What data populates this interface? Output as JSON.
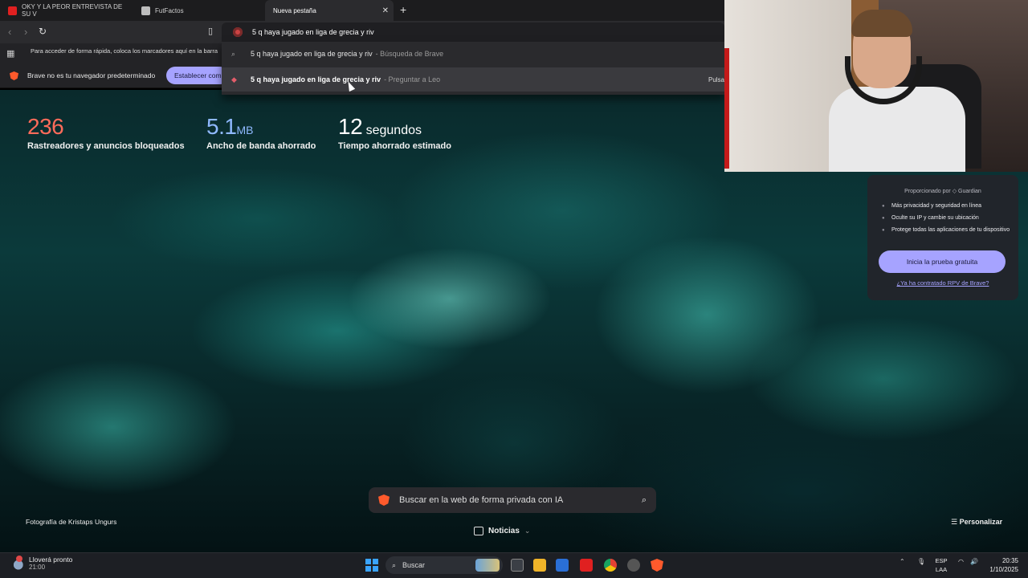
{
  "tabs": [
    {
      "title": "OKY Y LA PEOR ENTREVISTA DE SU V",
      "color": "#e02020"
    },
    {
      "title": "FutFactos",
      "color": "#cccccc"
    },
    {
      "title": "Nueva pestaña",
      "color": "#ffffff",
      "active": true
    }
  ],
  "omnibox": {
    "value": "5 q haya jugado en liga de grecia y riv"
  },
  "bookmarks_hint": "Para acceder de forma rápida, coloca los marcadores aquí en la barra",
  "infobar": {
    "message": "Brave no es tu navegador predeterminado",
    "button": "Establecer como predeterminado"
  },
  "suggestions": [
    {
      "query": "5 q haya jugado en liga de grecia y riv",
      "source": "- Búsqueda de Brave"
    },
    {
      "query": "5 q haya jugado en liga de grecia y riv",
      "source": "- Preguntar a Leo",
      "hint": "Pulsa"
    }
  ],
  "stats": [
    {
      "value": "236",
      "unit": "",
      "label": "Rastreadores y anuncios bloqueados",
      "color": "#ff6b5a"
    },
    {
      "value": "5.1",
      "unit": "MB",
      "label": "Ancho de banda ahorrado",
      "color": "#8fb9ff"
    },
    {
      "value": "12",
      "unit": "segundos",
      "label": "Tiempo ahorrado estimado",
      "color": "#ffffff"
    }
  ],
  "vpn": {
    "powered_by": "Proporcionado por ◇ Guardian",
    "features": [
      "Más privacidad y seguridad en línea",
      "Oculte su IP y cambie su ubicación",
      "Protege todas las aplicaciones de tu dispositivo"
    ],
    "cta": "Inicia la prueba gratuita",
    "link": "¿Ya ha contratado RPV de Brave?"
  },
  "ai_search": {
    "placeholder": "Buscar en la web de forma privada con IA"
  },
  "news": {
    "label": "Noticias"
  },
  "photo_credit": "Fotografía de Kristaps Ungurs",
  "customize": "☰ Personalizar",
  "taskbar": {
    "weather_title": "Lloverá pronto",
    "weather_time": "21:00",
    "search": "Buscar",
    "lang_1": "ESP",
    "lang_2": "LAA",
    "time": "20:35",
    "date": "1/10/2025"
  }
}
